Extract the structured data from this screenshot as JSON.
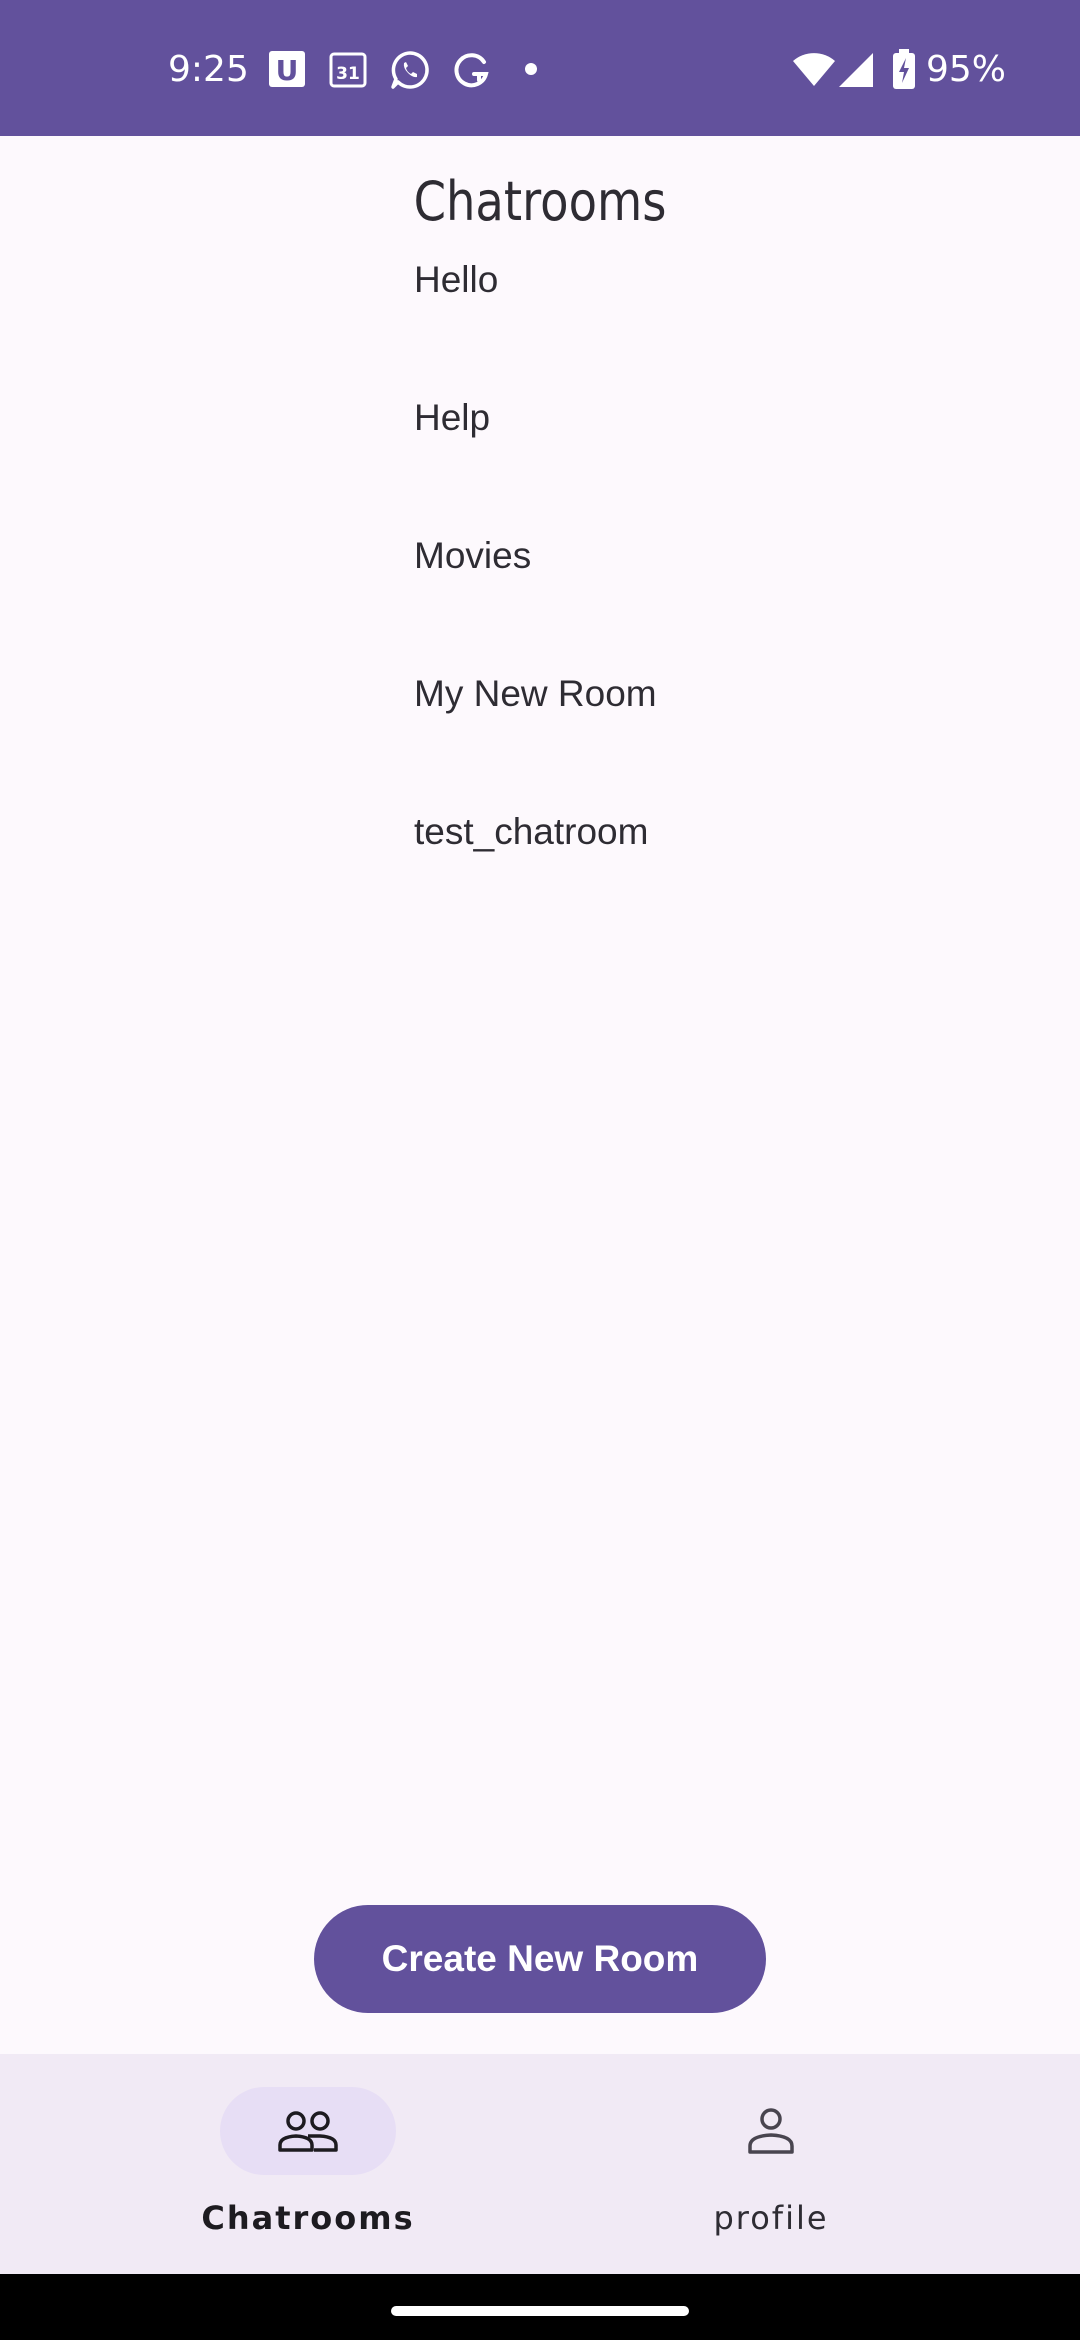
{
  "status_bar": {
    "time": "9:25",
    "battery_percent": "95%",
    "notification_icons": [
      "u-app-icon",
      "calendar-icon",
      "whatsapp-icon",
      "grammarly-icon",
      "dot-icon"
    ],
    "calendar_day": "31",
    "u_letter": "U",
    "background": "#62519C"
  },
  "page": {
    "title": "Chatrooms"
  },
  "rooms": [
    {
      "name": "Hello"
    },
    {
      "name": "Help"
    },
    {
      "name": "Movies"
    },
    {
      "name": "My New Room"
    },
    {
      "name": "test_chatroom"
    }
  ],
  "actions": {
    "create_room_label": "Create New Room"
  },
  "bottom_nav": {
    "items": [
      {
        "label": "Chatrooms",
        "icon": "people-icon",
        "selected": true
      },
      {
        "label": "profile",
        "icon": "person-icon",
        "selected": false
      }
    ]
  },
  "colors": {
    "accent": "#62519C",
    "background": "#FDF9FD",
    "nav_background": "#F1EAF5",
    "nav_indicator": "#E7DEF5"
  }
}
